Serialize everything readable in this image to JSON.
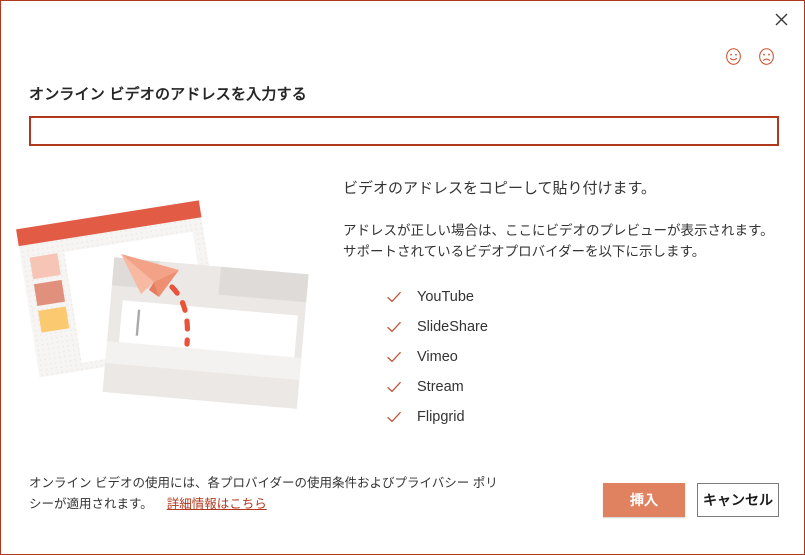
{
  "dialog": {
    "border_color": "#b0381f",
    "close_label": "×"
  },
  "feedback": {
    "happy_icon": "smiley-happy-icon",
    "sad_icon": "smiley-sad-icon",
    "color": "#d0502c"
  },
  "form": {
    "heading": "オンライン ビデオのアドレスを入力する",
    "input_value": "",
    "input_placeholder": ""
  },
  "illustration": {
    "name": "paste-video-address-illustration",
    "header_color": "#e15b45",
    "swatch_1": "#f6c5b6",
    "swatch_2": "#e0907c",
    "swatch_3": "#fbc96f",
    "plane_color": "#f4a287",
    "trail_color": "#e8533a"
  },
  "info": {
    "primary": "ビデオのアドレスをコピーして貼り付けます。",
    "secondary_line_1": "アドレスが正しい場合は、ここにビデオのプレビューが表示されます。",
    "secondary_line_2": "サポートされているビデオプロバイダーを以下に示します。"
  },
  "providers": {
    "check_color": "#c0553a",
    "items": [
      {
        "label": "YouTube"
      },
      {
        "label": "SlideShare"
      },
      {
        "label": "Vimeo"
      },
      {
        "label": "Stream"
      },
      {
        "label": "Flipgrid"
      }
    ]
  },
  "footer": {
    "note_line_1": "オンライン ビデオの使用には、各プロバイダーの使用条件およびプライバシー ポリ",
    "note_line_2": "シーが適用されます。",
    "link_label": "詳細情報はこちら",
    "insert_label": "挿入",
    "cancel_label": "キャンセル",
    "insert_color": "#e0815f"
  }
}
